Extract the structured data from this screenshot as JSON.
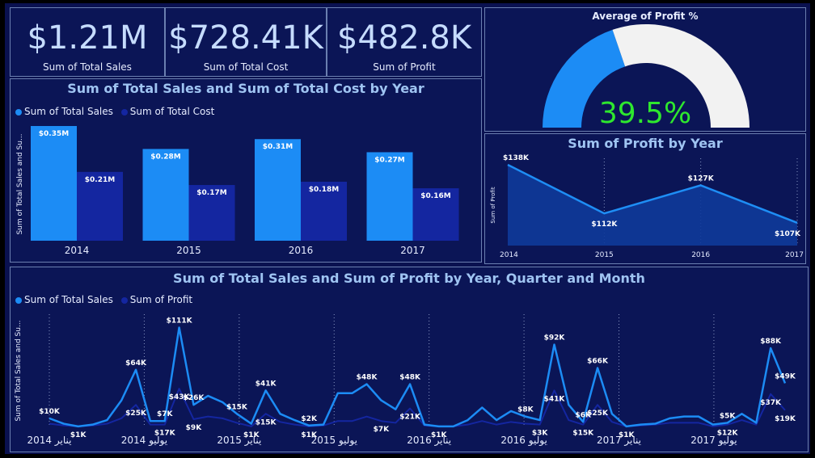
{
  "kpis": [
    {
      "value": "$1.21M",
      "label": "Sum of Total Sales"
    },
    {
      "value": "$728.41K",
      "label": "Sum of Total Cost"
    },
    {
      "value": "$482.8K",
      "label": "Sum of Profit"
    }
  ],
  "colors": {
    "sales": "#1c8cf5",
    "cost": "#1426a0",
    "profit_line": "#1e8ef5",
    "profit_area": "#0e3a9a",
    "gauge_fill": "#1c8cf5",
    "gauge_rest": "#f2f2f2",
    "gauge_text": "#2ee82e"
  },
  "chart_data": [
    {
      "type": "gauge",
      "title": "Average of Profit %",
      "value": 39.5,
      "value_label": "39.5%",
      "min": 0,
      "max": 100
    },
    {
      "type": "bar",
      "title": "Sum of Total Sales and Sum of Total Cost by Year",
      "ylabel": "Sum of Total Sales and Su...",
      "categories": [
        "2014",
        "2015",
        "2016",
        "2017"
      ],
      "series": [
        {
          "name": "Sum of Total Sales",
          "values": [
            0.35,
            0.28,
            0.31,
            0.27
          ],
          "labels": [
            "$0.35M",
            "$0.28M",
            "$0.31M",
            "$0.27M"
          ]
        },
        {
          "name": "Sum of Total Cost",
          "values": [
            0.21,
            0.17,
            0.18,
            0.16
          ],
          "labels": [
            "$0.21M",
            "$0.17M",
            "$0.18M",
            "$0.16M"
          ]
        }
      ],
      "ylim": [
        0,
        0.35
      ]
    },
    {
      "type": "area",
      "title": "Sum of Profit by Year",
      "ylabel": "Sum of Profit",
      "x": [
        "2014",
        "2015",
        "2016",
        "2017"
      ],
      "values": [
        138,
        112,
        127,
        107
      ],
      "labels": [
        "$138K",
        "$112K",
        "$127K",
        "$107K"
      ],
      "ylim": [
        100,
        138
      ]
    },
    {
      "type": "line",
      "title": "Sum of Total Sales and Sum of Profit by Year, Quarter and Month",
      "ylabel": "Sum of Total Sales and Su...",
      "x_ticks": [
        "2014 يناير",
        "2014 يوليو",
        "2015 يناير",
        "2015 يوليو",
        "2016 يناير",
        "2016 يوليو",
        "2017 يناير",
        "2017 يوليو"
      ],
      "series": [
        {
          "name": "Sum of Total Sales",
          "values": [
            10,
            4,
            1,
            3,
            8,
            30,
            64,
            7,
            7,
            111,
            25,
            35,
            28,
            15,
            4,
            41,
            15,
            8,
            2,
            3,
            38,
            38,
            48,
            30,
            20,
            48,
            3,
            1,
            1,
            8,
            22,
            8,
            18,
            12,
            8,
            92,
            25,
            6,
            66,
            15,
            1,
            3,
            4,
            10,
            12,
            12,
            3,
            5,
            15,
            5,
            88,
            49
          ]
        },
        {
          "name": "Sum of Profit",
          "values": [
            4,
            2,
            1,
            2,
            4,
            10,
            25,
            3,
            3,
            43,
            9,
            12,
            10,
            5,
            1,
            15,
            6,
            3,
            1,
            2,
            7,
            7,
            12,
            7,
            5,
            21,
            2,
            1,
            1,
            3,
            7,
            3,
            6,
            4,
            3,
            41,
            8,
            3,
            25,
            6,
            1,
            2,
            3,
            5,
            5,
            5,
            1,
            3,
            8,
            3,
            37,
            19
          ]
        }
      ],
      "data_labels": [
        {
          "series": 0,
          "index": 0,
          "text": "$10K"
        },
        {
          "series": 1,
          "index": 2,
          "text": "$1K"
        },
        {
          "series": 0,
          "index": 6,
          "text": "$64K"
        },
        {
          "series": 1,
          "index": 6,
          "text": "$25K"
        },
        {
          "series": 0,
          "index": 8,
          "text": "$7K"
        },
        {
          "series": 1,
          "index": 8,
          "text": "$17K"
        },
        {
          "series": 0,
          "index": 9,
          "text": "$111K"
        },
        {
          "series": 1,
          "index": 9,
          "text": "$43K"
        },
        {
          "series": 0,
          "index": 10,
          "text": "$26K"
        },
        {
          "series": 1,
          "index": 10,
          "text": "$9K"
        },
        {
          "series": 0,
          "index": 13,
          "text": "$15K"
        },
        {
          "series": 1,
          "index": 14,
          "text": "$1K"
        },
        {
          "series": 0,
          "index": 15,
          "text": "$41K"
        },
        {
          "series": 1,
          "index": 15,
          "text": "$15K"
        },
        {
          "series": 0,
          "index": 18,
          "text": "$2K"
        },
        {
          "series": 1,
          "index": 18,
          "text": "$1K"
        },
        {
          "series": 0,
          "index": 22,
          "text": "$48K"
        },
        {
          "series": 1,
          "index": 23,
          "text": "$7K"
        },
        {
          "series": 0,
          "index": 25,
          "text": "$48K"
        },
        {
          "series": 1,
          "index": 25,
          "text": "$21K"
        },
        {
          "series": 1,
          "index": 27,
          "text": "$1K"
        },
        {
          "series": 0,
          "index": 33,
          "text": "$8K"
        },
        {
          "series": 1,
          "index": 34,
          "text": "$3K"
        },
        {
          "series": 0,
          "index": 35,
          "text": "$92K"
        },
        {
          "series": 1,
          "index": 35,
          "text": "$41K"
        },
        {
          "series": 0,
          "index": 37,
          "text": "$6K"
        },
        {
          "series": 1,
          "index": 37,
          "text": "$15K"
        },
        {
          "series": 0,
          "index": 38,
          "text": "$66K"
        },
        {
          "series": 1,
          "index": 38,
          "text": "$25K"
        },
        {
          "series": 1,
          "index": 40,
          "text": "$1K"
        },
        {
          "series": 0,
          "index": 47,
          "text": "$5K"
        },
        {
          "series": 1,
          "index": 47,
          "text": "$12K"
        },
        {
          "series": 0,
          "index": 50,
          "text": "$88K"
        },
        {
          "series": 0,
          "index": 51,
          "text": "$49K"
        },
        {
          "series": 1,
          "index": 50,
          "text": "$37K"
        },
        {
          "series": 1,
          "index": 51,
          "text": "$19K"
        }
      ],
      "ylim": [
        0,
        115
      ]
    }
  ]
}
